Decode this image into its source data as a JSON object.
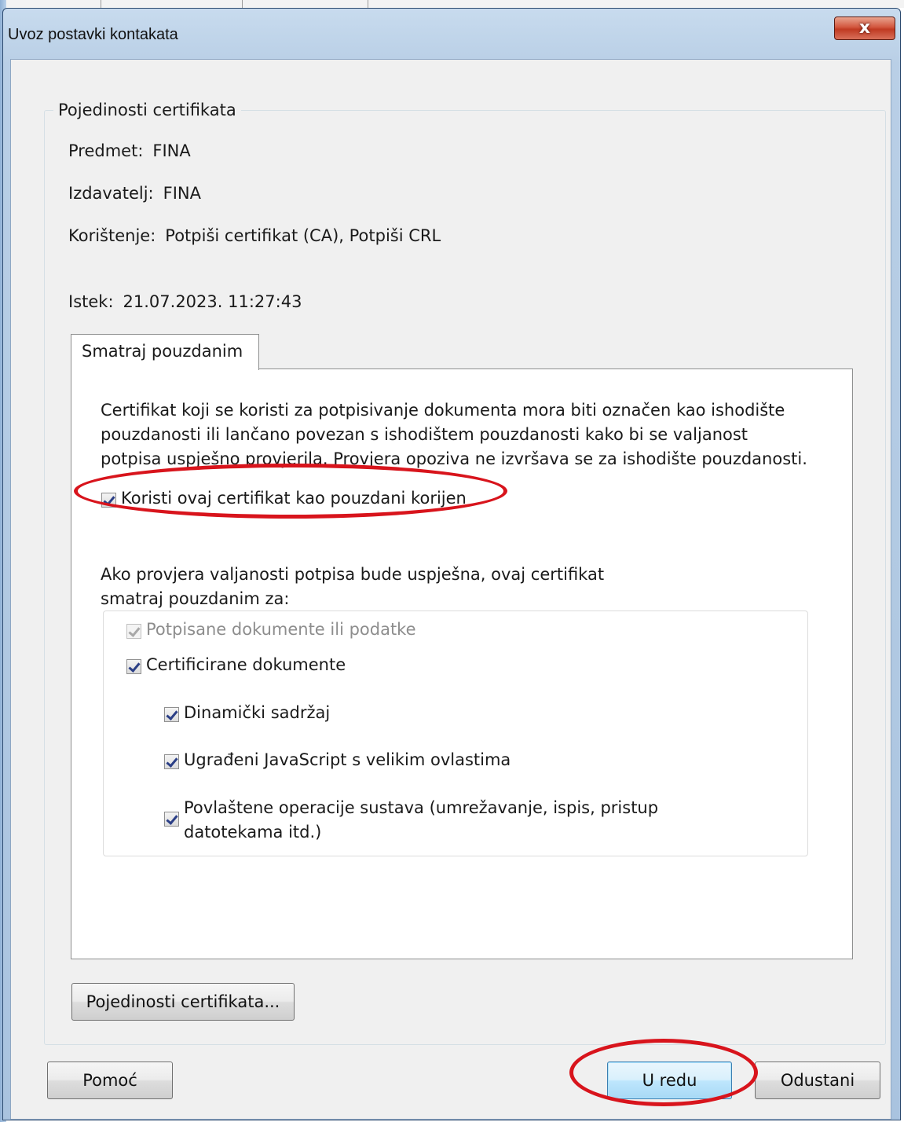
{
  "window": {
    "title": "Uvoz postavki kontakata",
    "close_glyph": "x"
  },
  "details": {
    "group_label": "Pojedinosti certifikata",
    "subject_label": "Predmet:",
    "subject_value": "FINA",
    "issuer_label": "Izdavatelj:",
    "issuer_value": "FINA",
    "usage_label": "Korištenje:",
    "usage_value": "Potpiši certifikat (CA), Potpiši CRL",
    "expiry_label": "Istek:",
    "expiry_value": "21.07.2023. 11:27:43"
  },
  "trust_tab": {
    "tab_label": "Smatraj pouzdanim",
    "description": [
      "Certifikat koji se koristi za potpisivanje dokumenta mora biti označen kao ishodište",
      "pouzdanosti ili lančano povezan s ishodištem pouzdanosti kako bi se valjanost",
      "potpisa uspješno provjerila. Provjera opoziva ne izvršava se za ishodište pouzdanosti."
    ],
    "root_checkbox": {
      "label": "Koristi ovaj certifikat kao pouzdani korijen",
      "checked": true
    },
    "trust_for_text": [
      "Ako provjera valjanosti potpisa bude uspješna, ovaj certifikat",
      "smatraj pouzdanim za:"
    ],
    "options": {
      "signed_docs": {
        "label": "Potpisane dokumente ili podatke",
        "checked": true,
        "disabled": true
      },
      "certified_docs": {
        "label": "Certificirane dokumente",
        "checked": true
      },
      "dynamic_content": {
        "label": "Dinamički sadržaj",
        "checked": true
      },
      "embedded_js": {
        "label": "Ugrađeni JavaScript s velikim ovlastima",
        "checked": true
      },
      "privileged_ops": {
        "label_line1": "Povlaštene operacije sustava (umrežavanje, ispis, pristup",
        "label_line2": "datotekama itd.)",
        "checked": true
      }
    }
  },
  "buttons": {
    "certificate_details": "Pojedinosti certifikata...",
    "help": "Pomoć",
    "ok": "U redu",
    "cancel": "Odustani"
  },
  "annotation_color": "#d8141c"
}
